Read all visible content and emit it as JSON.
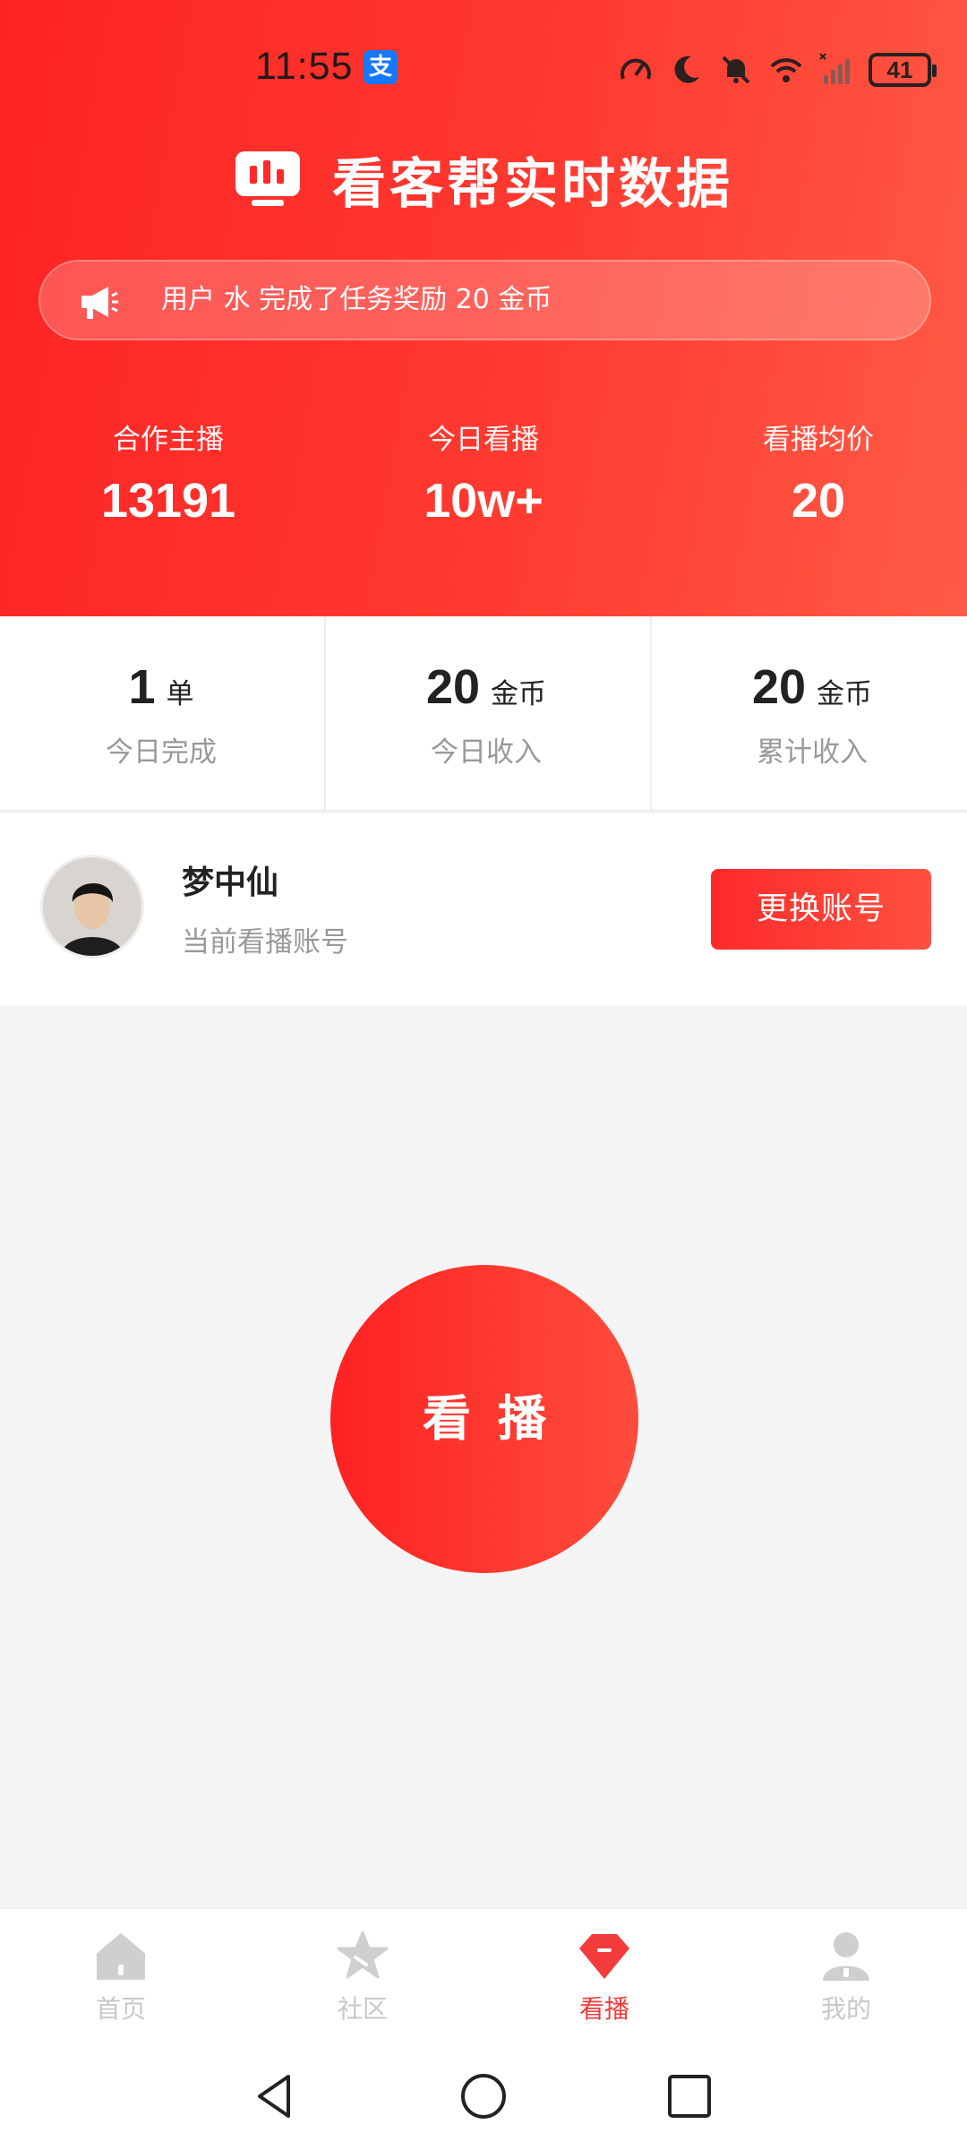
{
  "status_bar": {
    "time": "11:55",
    "alipay_badge": "支",
    "battery": "41"
  },
  "header": {
    "title": "看客帮实时数据",
    "logo_icon": "chart-board-icon"
  },
  "ticker": {
    "icon": "megaphone-icon",
    "text": "用户 水 完成了任务奖励 20 金币"
  },
  "stats": [
    {
      "label": "合作主播",
      "value": "13191"
    },
    {
      "label": "今日看播",
      "value": "10w+"
    },
    {
      "label": "看播均价",
      "value": "20"
    }
  ],
  "summary": [
    {
      "number": "1",
      "unit": "单",
      "label": "今日完成"
    },
    {
      "number": "20",
      "unit": "金币",
      "label": "今日收入"
    },
    {
      "number": "20",
      "unit": "金币",
      "label": "累计收入"
    }
  ],
  "account": {
    "name": "梦中仙",
    "subtitle": "当前看播账号",
    "switch_label": "更换账号"
  },
  "main": {
    "watch_label": "看播"
  },
  "tabs": [
    {
      "label": "首页",
      "icon": "home-icon",
      "active": false
    },
    {
      "label": "社区",
      "icon": "star-icon",
      "active": false
    },
    {
      "label": "看播",
      "icon": "gem-icon",
      "active": true
    },
    {
      "label": "我的",
      "icon": "person-icon",
      "active": false
    }
  ],
  "colors": {
    "brand_red": "#fe2323",
    "brand_red_light": "#ff5b46",
    "active_tab": "#f23b3b",
    "inactive_tab": "#c8c8c8"
  }
}
